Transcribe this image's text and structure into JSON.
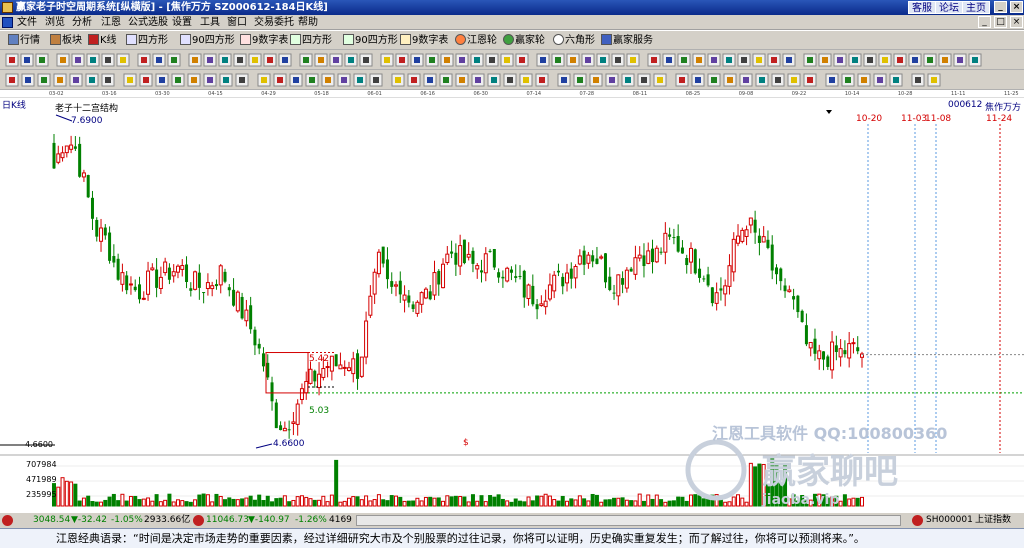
{
  "window": {
    "title": "赢家老子时空周期系统[纵横版] - [焦作万方  SZ000612-184日K线]",
    "links": [
      "客服",
      "论坛",
      "主页"
    ],
    "controls": [
      "_",
      "□",
      "×"
    ]
  },
  "menu": [
    "文件",
    "浏览",
    "分析",
    "江恩",
    "公式选股",
    "设置",
    "工具",
    "窗口",
    "交易委托",
    "帮助"
  ],
  "menu_controls": [
    "_",
    "□",
    "×"
  ],
  "toolbar1": [
    "行情",
    "板块",
    "K线",
    "四方形",
    "90四方形",
    "9数字表",
    "四方形",
    "90四方形",
    "9数字表",
    "江恩轮",
    "赢家轮",
    "六角形",
    "赢家服务"
  ],
  "date_axis": [
    "03-02",
    "03-16",
    "03-30",
    "04-15",
    "04-29",
    "05-18",
    "06-01",
    "06-16",
    "06-30",
    "07-14",
    "07-28",
    "08-11",
    "08-25",
    "09-08",
    "09-22",
    "10-14",
    "10-28",
    "11-11",
    "11-25"
  ],
  "chart": {
    "period_label": "日K线",
    "indicator_label": "老子十二宫结构",
    "stock_code": "000612",
    "stock_name": "焦作万方",
    "high_label": "7.6900",
    "low_label": "4.6600",
    "axis_low": "4.6600",
    "box_top": "5.42",
    "box_bottom": "5.03",
    "dollar_mark": "$",
    "future_dates": [
      "10-20",
      "11-03",
      "11-08",
      "11-24"
    ],
    "volume_ticks": [
      "707984",
      "471989",
      "235995"
    ],
    "watermark_1": "江恩工具软件  QQ:100800360",
    "watermark_2": "赢家聊吧",
    "watermark_3": "jiaoba.vip"
  },
  "chart_data": {
    "type": "candlestick",
    "title": "老子十二宫结构",
    "stock": "焦作万方 000612",
    "period": "日K线",
    "ylim": [
      4.45,
      7.8
    ],
    "labels": {
      "high": 7.69,
      "low": 4.66,
      "box_top": 5.42,
      "box_bottom": 5.03
    },
    "future_dates": [
      "10-20",
      "11-03",
      "11-08",
      "11-24"
    ],
    "close_path": [
      7.2,
      7.5,
      7.4,
      7.0,
      6.6,
      6.5,
      6.2,
      6.1,
      6.0,
      6.1,
      6.15,
      6.2,
      6.25,
      6.1,
      6.05,
      6.1,
      6.2,
      6.0,
      5.8,
      5.6,
      5.3,
      4.8,
      4.7,
      4.9,
      5.1,
      5.2,
      5.3,
      5.3,
      5.35,
      5.25,
      5.8,
      6.3,
      6.0,
      6.1,
      5.9,
      5.95,
      6.0,
      6.3,
      6.4,
      6.3,
      6.25,
      6.3,
      6.3,
      6.2,
      6.1,
      6.0,
      5.95,
      6.05,
      6.1,
      6.2,
      6.35,
      6.4,
      6.3,
      6.1,
      6.15,
      6.3,
      6.4,
      6.3,
      6.45,
      6.5,
      6.4,
      6.3,
      6.2,
      5.95,
      6.1,
      6.5,
      6.7,
      6.5,
      6.4,
      6.0,
      6.05,
      5.7,
      5.4,
      5.35,
      5.4,
      5.42,
      5.45,
      5.42
    ],
    "volume_ticks": [
      707984,
      471989,
      235995
    ],
    "volume_ymax": 900000
  },
  "status": {
    "sh_index": "3048.54",
    "sh_change": "▼-32.42",
    "sh_pct": "-1.05%",
    "sh_amount": "2933.66亿",
    "sz_index": "11046.73",
    "sz_change": "▼-140.97",
    "sz_pct": "-1.26%",
    "sz_amount": "4169",
    "right_code": "SH000001",
    "right_name": "上证指数"
  },
  "quote": "江恩经典语录：“时间是决定市场走势的重要因素，经过详细研究大市及个别股票的过往记录，你将可以证明，历史确实重复发生；而了解过往，你将可以预测将来。”。",
  "colors": {
    "up": "#d40000",
    "down": "#008000",
    "title_bar": "#0a2a8a",
    "grid": "#00a000"
  }
}
